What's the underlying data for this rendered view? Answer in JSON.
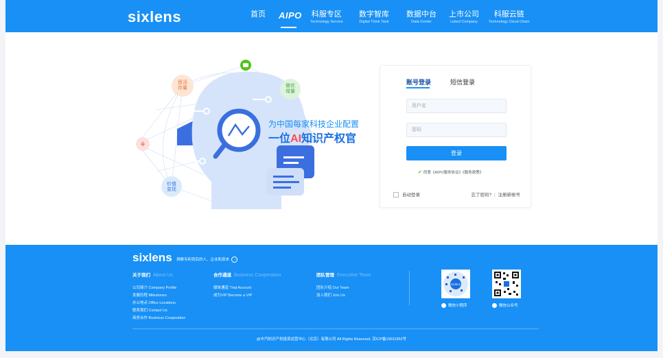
{
  "header": {
    "logo": "sixlens",
    "nav": [
      {
        "label": "首页",
        "sub": ""
      },
      {
        "label": "AIPO",
        "sub": ""
      },
      {
        "label": "科服专区",
        "sub": "Technology Service"
      },
      {
        "label": "数字智库",
        "sub": "Digital Think Tank"
      },
      {
        "label": "数据中台",
        "sub": "Data Center"
      },
      {
        "label": "上市公司",
        "sub": "Listed Company"
      },
      {
        "label": "科服云链",
        "sub": "Technology Cloud Chain"
      }
    ]
  },
  "hero": {
    "bubbles": [
      "盘活存量",
      "做优增量",
      "价值变现"
    ],
    "slogan_line1": "为中国每家科技企业配置",
    "slogan_line2_prefix": "一位",
    "slogan_line2_ai": "AI",
    "slogan_line2_suffix": "知识产权官"
  },
  "login": {
    "tabs": [
      "账号登录",
      "短信登录"
    ],
    "username_placeholder": "用户名",
    "password_placeholder": "密码",
    "submit_label": "登录",
    "agreement": "同意《AIPO服务协议》《服务政策》",
    "remember_label": "自动登录",
    "forgot_label": "忘了密码?",
    "separator": "|",
    "register_label": "注册新帐号"
  },
  "footer": {
    "logo": "sixlens",
    "tagline": "洞察专利背后的人、企业和资本",
    "columns": [
      {
        "title": "关于我们",
        "title_en": "About Us",
        "links": [
          "公司简介 Company Profile",
          "发展历程 Milestones",
          "办公地点 Office Locations",
          "联系我们 Contact Us",
          "商务合作 Business Cooperation"
        ]
      },
      {
        "title": "合作通道",
        "title_en": "Business Cooperation",
        "links": [
          "媒体通道 Trial Account",
          "成为VIP    Become a VIP"
        ]
      },
      {
        "title": "团队管理",
        "title_en": "Executive Team",
        "links": [
          "团队介绍 Our Team",
          "加入我们 Join Us"
        ]
      }
    ],
    "qr": [
      {
        "label": "微信小程序",
        "center": "sixlens"
      },
      {
        "label": "微信公众号",
        "center": ""
      }
    ],
    "copyright": "@中汽知识产权投资运营中心（北京）有限公司   All Rights Reserved. 京ICP备19011952号"
  },
  "colors": {
    "brand_blue": "#1890f5",
    "accent_red": "#ff4d4f",
    "check_green": "#52c41a"
  }
}
